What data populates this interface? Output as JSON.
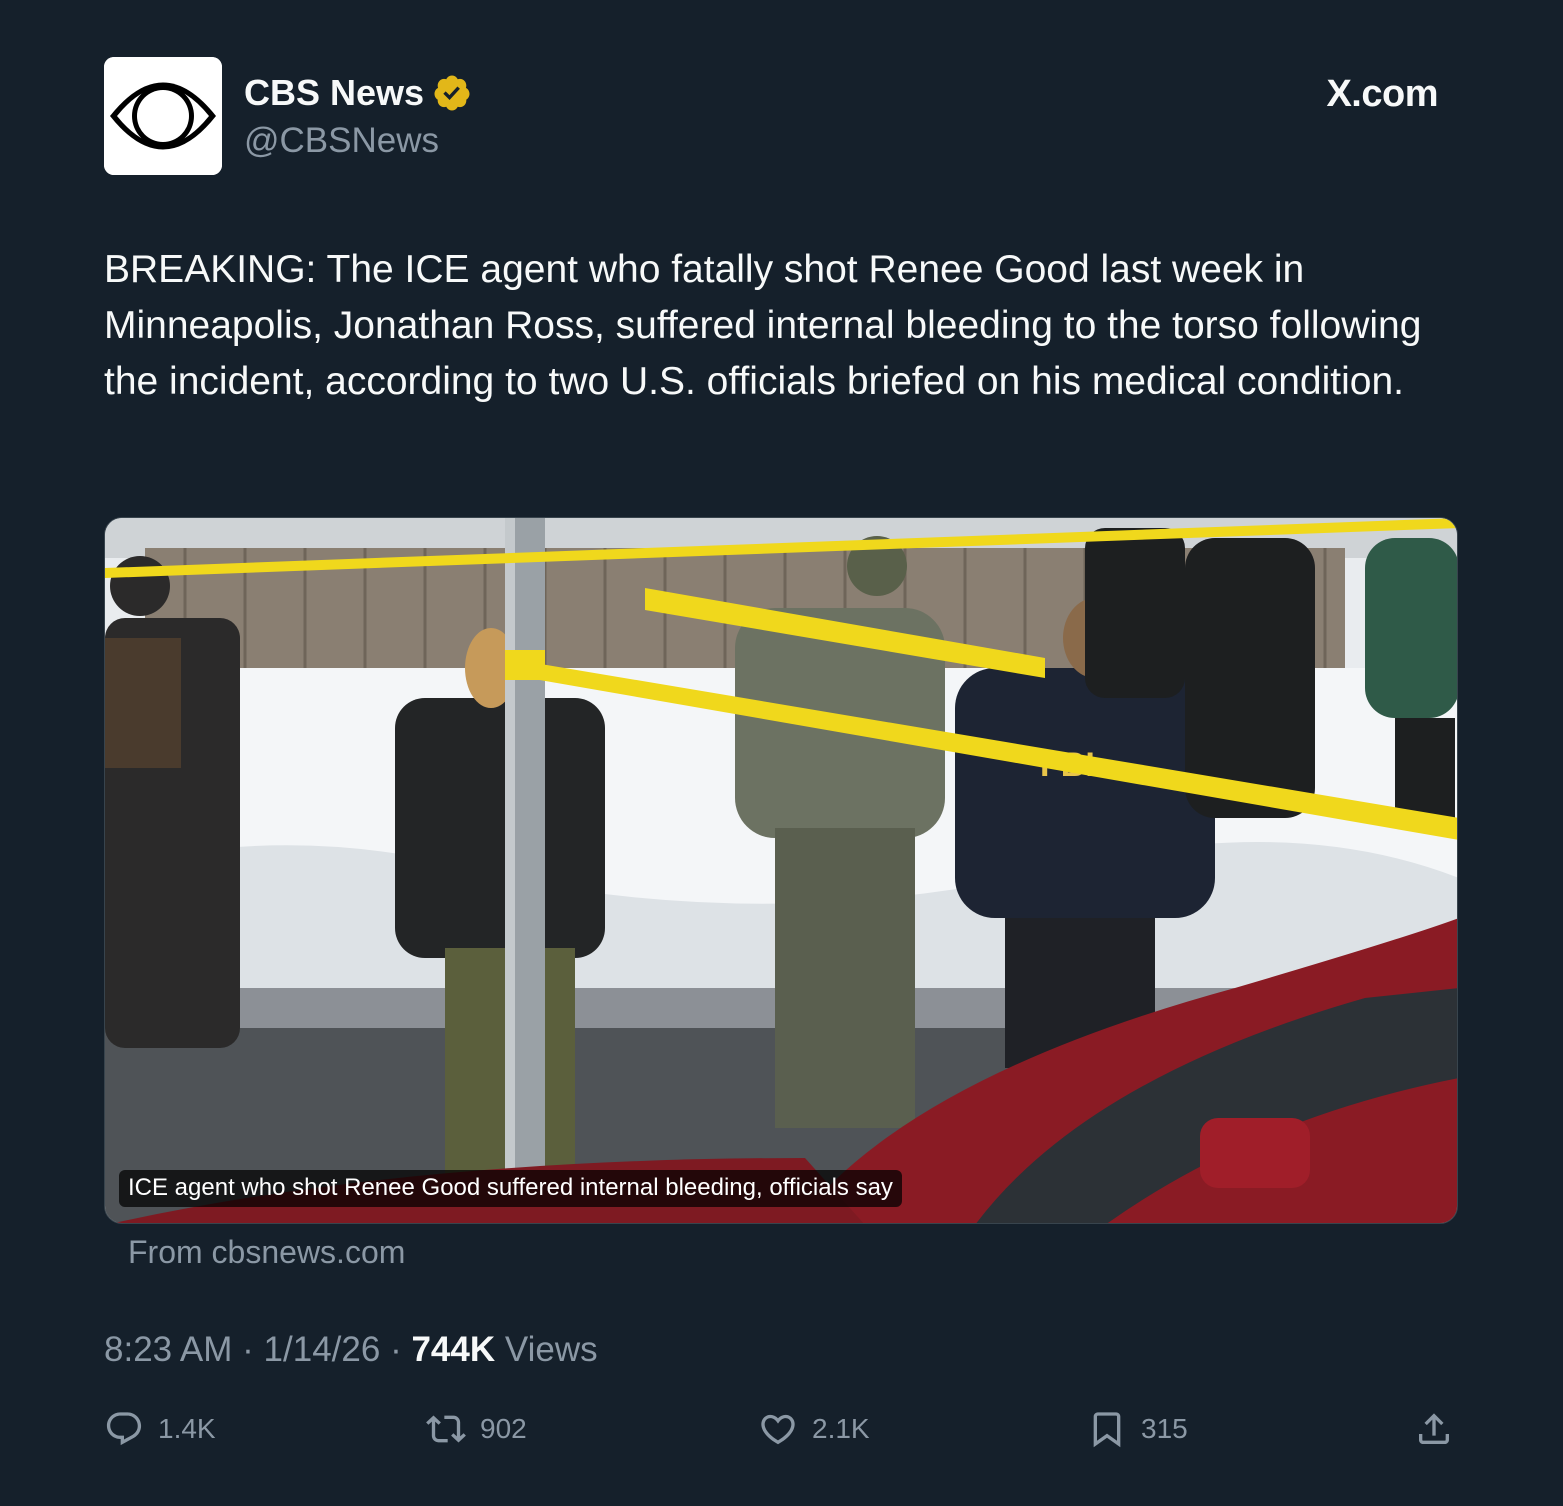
{
  "account": {
    "display_name": "CBS News",
    "handle": "@CBSNews",
    "verified_icon": "verified-gold-badge-icon",
    "avatar_icon": "cbs-eye-logo-icon"
  },
  "site_label": "X.com",
  "tweet": {
    "text": "BREAKING: The ICE agent who fatally shot Renee Good last week in Minneapolis, Jonathan Ross, suffered internal bleeding to the torso following the incident, according to two U.S. officials briefed on his medical condition."
  },
  "link_card": {
    "caption": "ICE agent who shot Renee Good suffered internal bleeding, officials say",
    "source": "From cbsnews.com"
  },
  "meta": {
    "time": "8:23 AM",
    "separator": "·",
    "date": "1/14/26",
    "views_count": "744K",
    "views_label": "Views"
  },
  "actions": {
    "replies": "1.4K",
    "reposts": "902",
    "likes": "2.1K",
    "bookmarks": "315"
  },
  "colors": {
    "background": "#15202b",
    "text_primary": "#f7f9f9",
    "text_secondary": "#8b98a5",
    "verified_gold": "#e2b719"
  }
}
